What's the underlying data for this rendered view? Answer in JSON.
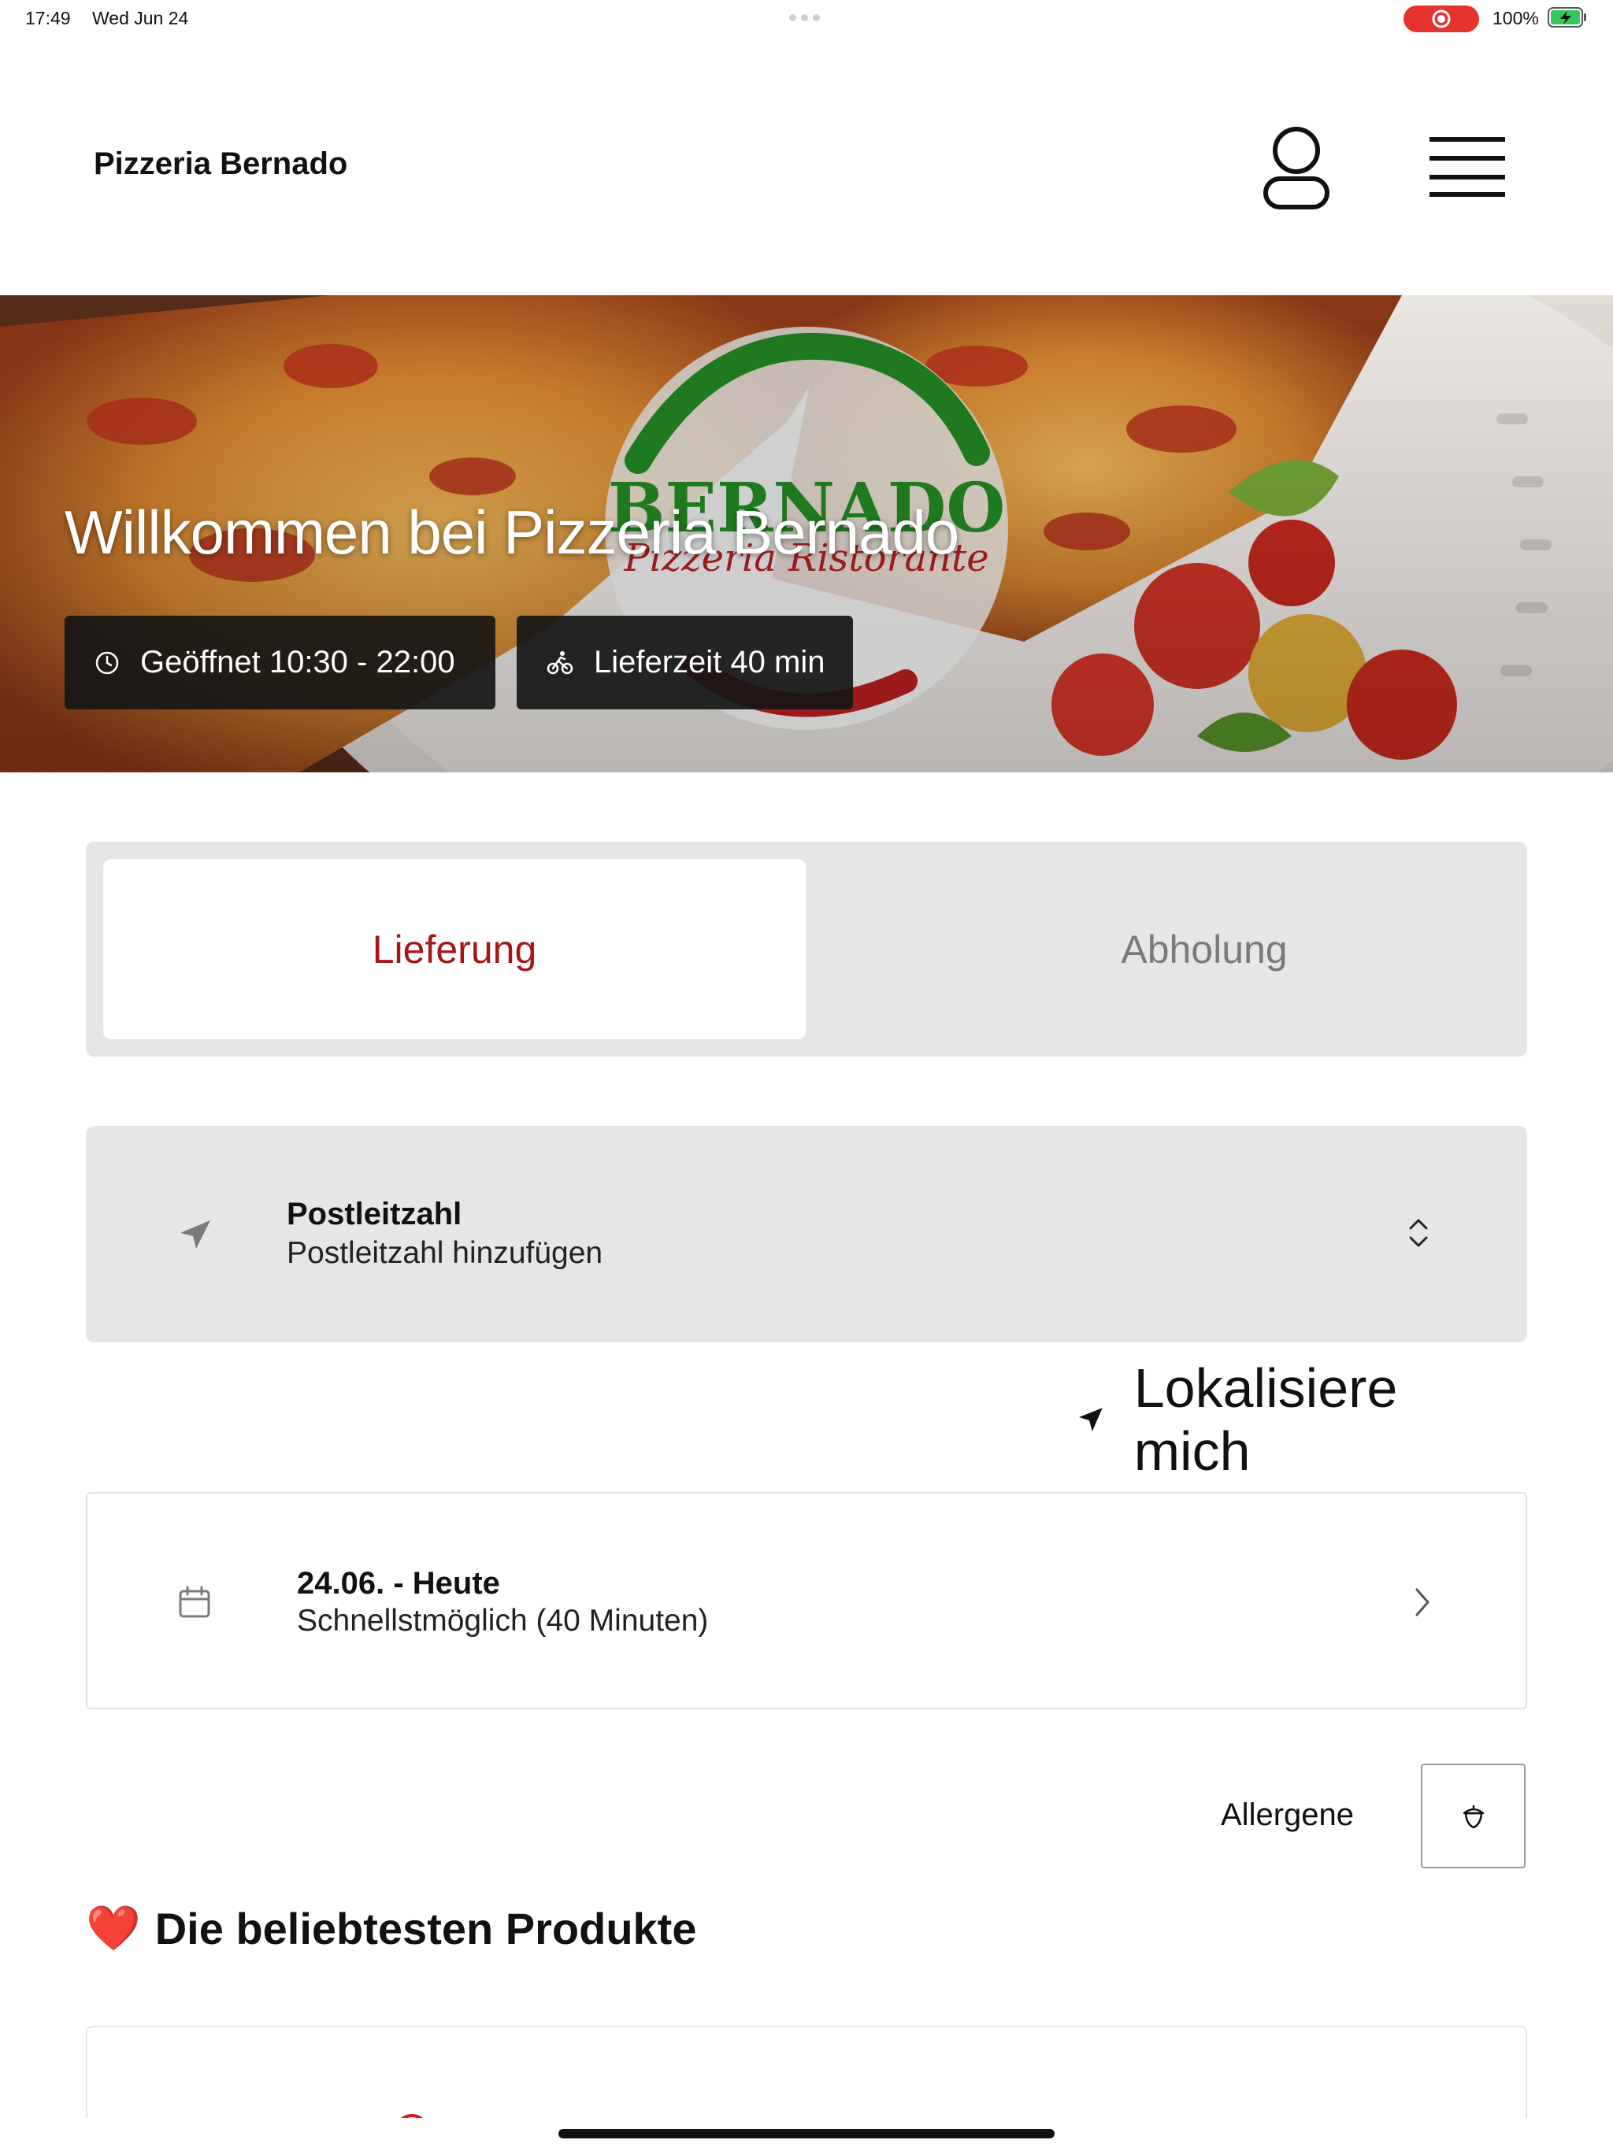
{
  "status_bar": {
    "time": "17:49",
    "date": "Wed Jun 24",
    "battery": "100%",
    "record_color": "#e5322d",
    "battery_color": "#34c759"
  },
  "header": {
    "brand": "Pizzeria Bernado",
    "user_icon": "user-icon",
    "menu_icon": "hamburger-menu-icon"
  },
  "hero": {
    "title": "Willkommen bei Pizzeria Bernado",
    "logo_text": "BERNADO",
    "logo_subtext": "Pizzeria Ristorante",
    "opening_hours": "Geöffnet 10:30 - 22:00",
    "delivery_time": "Lieferzeit 40 min",
    "clock_icon": "clock-icon",
    "bike_icon": "bicycle-icon"
  },
  "order_type": {
    "tabs": [
      {
        "label": "Lieferung",
        "selected": true
      },
      {
        "label": "Abholung",
        "selected": false
      }
    ],
    "active_color": "#a51717"
  },
  "zip": {
    "title": "Postleitzahl",
    "placeholder": "Postleitzahl hinzufügen",
    "icon": "navigation-arrow-icon",
    "chevron_icon": "chevron-up-down-icon"
  },
  "locate": {
    "label": "Lokalisiere mich",
    "icon": "location-arrow-icon"
  },
  "delivery_date": {
    "title": "24.06. - Heute",
    "subtitle": "Schnellstmöglich (40 Minuten)",
    "icon": "calendar-icon",
    "chevron_icon": "chevron-right-icon"
  },
  "allergens": {
    "label": "Allergene",
    "icon": "acorn-icon"
  },
  "popular": {
    "emoji": "❤️",
    "title": "Die beliebtesten Produkte"
  }
}
